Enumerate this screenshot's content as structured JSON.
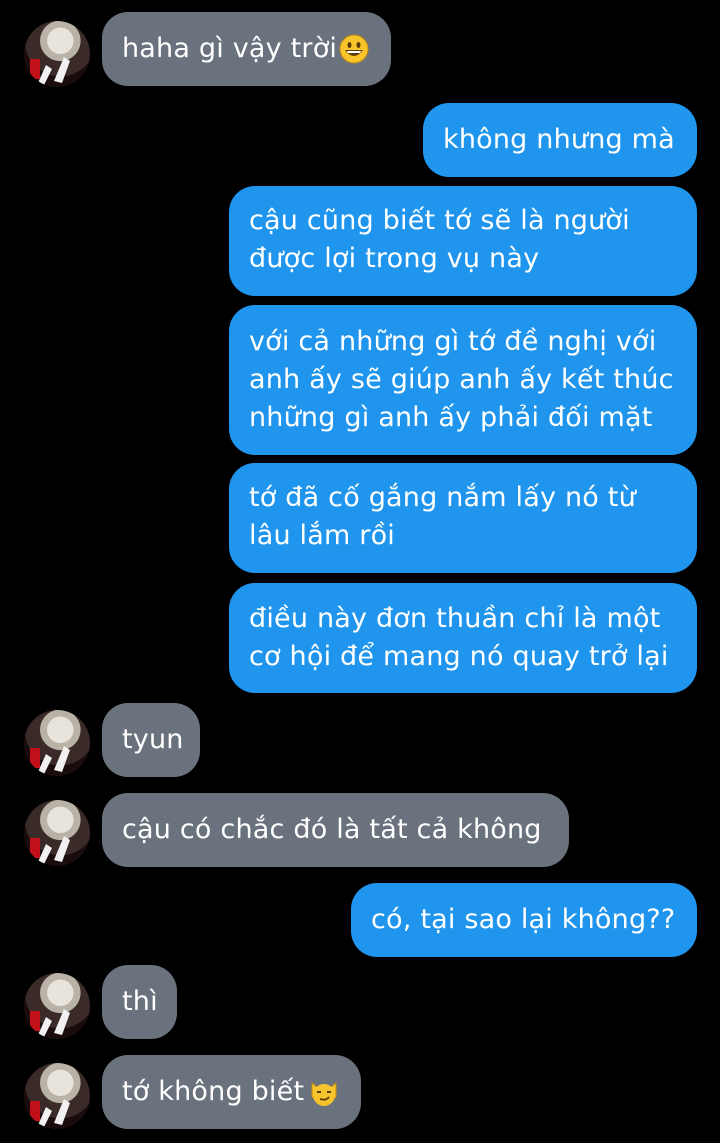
{
  "colors": {
    "background": "#000000",
    "received_bubble": "#6a737d",
    "sent_bubble": "#1f95ee",
    "text": "#ffffff"
  },
  "messages": [
    {
      "side": "received",
      "text": "haha gì vậy trời",
      "emoji": "grinning-face-icon"
    },
    {
      "side": "sent",
      "text": "không nhưng mà"
    },
    {
      "side": "sent",
      "text": "cậu cũng biết tớ sẽ là người\nđược lợi trong vụ này"
    },
    {
      "side": "sent",
      "text": "với cả những gì tớ đề nghị với\nanh ấy sẽ giúp anh ấy kết thúc\nnhững gì anh ấy phải đối mặt"
    },
    {
      "side": "sent",
      "text": "tớ đã cố gắng nắm lấy nó từ\nlâu lắm rồi"
    },
    {
      "side": "sent",
      "text": "điều này đơn thuần chỉ là một\ncơ hội để mang nó quay trở lại"
    },
    {
      "side": "received",
      "text": "tyun"
    },
    {
      "side": "received",
      "text": "cậu có chắc đó là tất cả không"
    },
    {
      "side": "sent",
      "text": "có, tại sao lại không??"
    },
    {
      "side": "received",
      "text": "thì"
    },
    {
      "side": "received",
      "text": "tớ không biết",
      "emoji": "smirking-cat-icon"
    }
  ]
}
